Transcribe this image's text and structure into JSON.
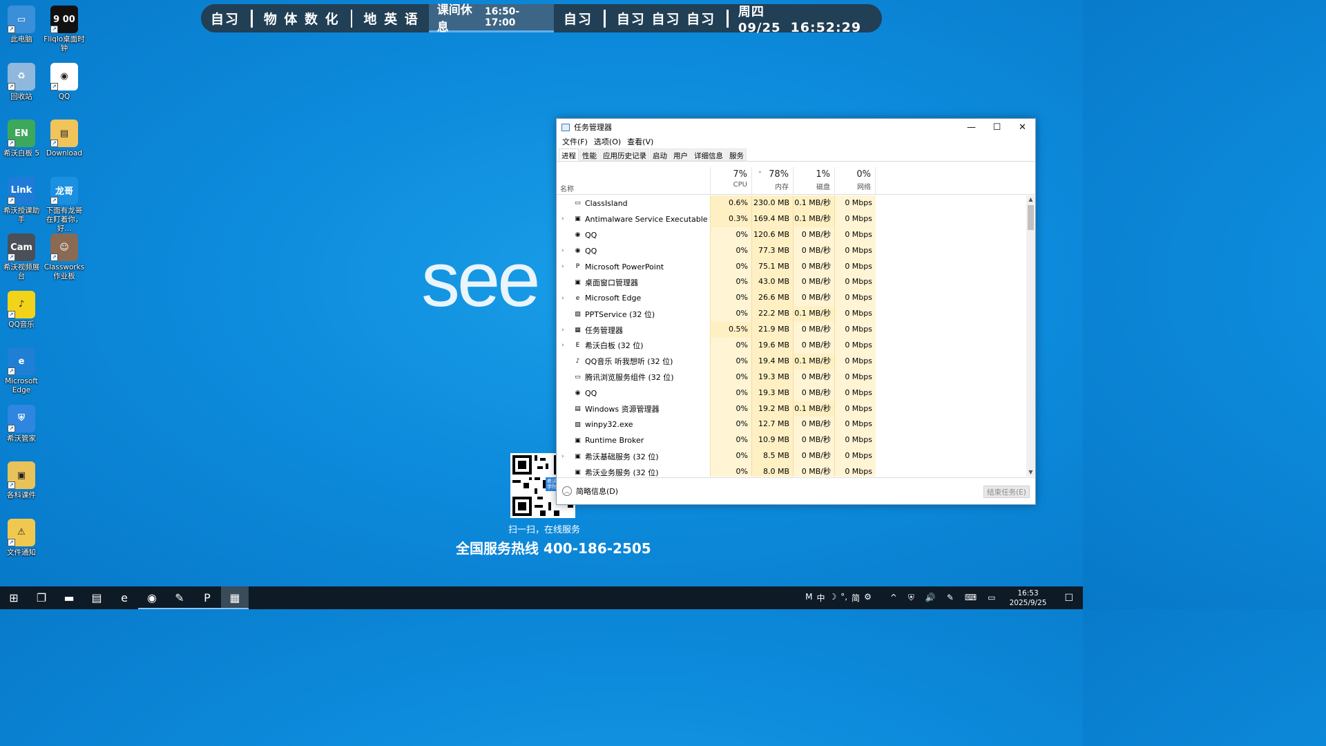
{
  "desktop_icons": [
    {
      "id": "this-pc",
      "label": "此电脑",
      "glyph": "▭",
      "color": "#3a8fd8",
      "col": 0,
      "row": 0
    },
    {
      "id": "fliqlo",
      "label": "Fliqlo桌面时钟",
      "glyph": "9 00",
      "color": "#111111",
      "col": 1,
      "row": 0
    },
    {
      "id": "recycle-bin",
      "label": "回收站",
      "glyph": "♻",
      "color": "#8fb8dc",
      "col": 0,
      "row": 1
    },
    {
      "id": "qq",
      "label": "QQ",
      "glyph": "◉",
      "color": "#ffffff",
      "col": 1,
      "row": 1
    },
    {
      "id": "easinote",
      "label": "希沃白板 5",
      "glyph": "EN",
      "color": "#3da85c",
      "col": 0,
      "row": 2
    },
    {
      "id": "download",
      "label": "Download",
      "glyph": "▤",
      "color": "#f0c45a",
      "col": 1,
      "row": 2
    },
    {
      "id": "link",
      "label": "希沃授课助手",
      "glyph": "Link",
      "color": "#1e7bd8",
      "col": 0,
      "row": 3
    },
    {
      "id": "longge",
      "label": "下面有龙哥在盯着你，好...",
      "glyph": "龙哥",
      "color": "#1b8fe0",
      "col": 1,
      "row": 3
    },
    {
      "id": "camera",
      "label": "希沃视频展台",
      "glyph": "Cam",
      "color": "#4a4f58",
      "col": 0,
      "row": 4
    },
    {
      "id": "classworks",
      "label": "Classworks作业板",
      "glyph": "☺",
      "color": "#8a6a52",
      "col": 1,
      "row": 4
    },
    {
      "id": "qqmusic",
      "label": "QQ音乐",
      "glyph": "♪",
      "color": "#f2d31a",
      "col": 0,
      "row": 5
    },
    {
      "id": "edge",
      "label": "Microsoft Edge",
      "glyph": "e",
      "color": "#1f7fd4",
      "col": 0,
      "row": 6
    },
    {
      "id": "seewo-guard",
      "label": "希沃管家",
      "glyph": "⛨",
      "color": "#2f86e0",
      "col": 0,
      "row": 7
    },
    {
      "id": "courseware",
      "label": "各科课件",
      "glyph": "▣",
      "color": "#e8c35a",
      "col": 0,
      "row": 8
    },
    {
      "id": "file-notice",
      "label": "文件通知",
      "glyph": "⚠",
      "color": "#f0c850",
      "col": 0,
      "row": 9
    }
  ],
  "schedule": {
    "items": [
      "自习",
      "物 体 数 化",
      "地 英 语"
    ],
    "current_label": "课间休息",
    "current_time": "16:50-17:00",
    "after": [
      "自习",
      "自习 自习 自习"
    ],
    "date": "周四 09/25",
    "time": "16:52:29"
  },
  "wallpaper": {
    "logo": "see",
    "qr_badge": "希沃学院",
    "qr_caption": "扫一扫，在线服务",
    "hotline": "全国服务热线 400-186-2505"
  },
  "taskmgr": {
    "title": "任务管理器",
    "menu": [
      "文件(F)",
      "选项(O)",
      "查看(V)"
    ],
    "tabs": [
      "进程",
      "性能",
      "应用历史记录",
      "启动",
      "用户",
      "详细信息",
      "服务"
    ],
    "selected_tab": 0,
    "name_header": "名称",
    "columns": [
      {
        "pct": "7%",
        "name": "CPU"
      },
      {
        "pct": "78%",
        "name": "内存"
      },
      {
        "pct": "1%",
        "name": "磁盘"
      },
      {
        "pct": "0%",
        "name": "网络"
      }
    ],
    "processes": [
      {
        "name": "ClassIsland",
        "expandable": false,
        "icon": "▭",
        "cpu": "0.6%",
        "mem": "230.0 MB",
        "disk": "0.1 MB/秒",
        "net": "0 Mbps"
      },
      {
        "name": "Antimalware Service Executable",
        "expandable": true,
        "icon": "▣",
        "cpu": "0.3%",
        "mem": "169.4 MB",
        "disk": "0.1 MB/秒",
        "net": "0 Mbps"
      },
      {
        "name": "QQ",
        "expandable": false,
        "icon": "◉",
        "cpu": "0%",
        "mem": "120.6 MB",
        "disk": "0 MB/秒",
        "net": "0 Mbps"
      },
      {
        "name": "QQ",
        "expandable": true,
        "icon": "◉",
        "cpu": "0%",
        "mem": "77.3 MB",
        "disk": "0 MB/秒",
        "net": "0 Mbps"
      },
      {
        "name": "Microsoft PowerPoint",
        "expandable": true,
        "icon": "P",
        "cpu": "0%",
        "mem": "75.1 MB",
        "disk": "0 MB/秒",
        "net": "0 Mbps"
      },
      {
        "name": "桌面窗口管理器",
        "expandable": false,
        "icon": "▣",
        "cpu": "0%",
        "mem": "43.0 MB",
        "disk": "0 MB/秒",
        "net": "0 Mbps"
      },
      {
        "name": "Microsoft Edge",
        "expandable": true,
        "icon": "e",
        "cpu": "0%",
        "mem": "26.6 MB",
        "disk": "0 MB/秒",
        "net": "0 Mbps"
      },
      {
        "name": "PPTService (32 位)",
        "expandable": false,
        "icon": "▨",
        "cpu": "0%",
        "mem": "22.2 MB",
        "disk": "0.1 MB/秒",
        "net": "0 Mbps"
      },
      {
        "name": "任务管理器",
        "expandable": true,
        "icon": "▦",
        "cpu": "0.5%",
        "mem": "21.9 MB",
        "disk": "0 MB/秒",
        "net": "0 Mbps"
      },
      {
        "name": "希沃白板 (32 位)",
        "expandable": true,
        "icon": "E",
        "cpu": "0%",
        "mem": "19.6 MB",
        "disk": "0 MB/秒",
        "net": "0 Mbps"
      },
      {
        "name": "QQ音乐 听我想听 (32 位)",
        "expandable": false,
        "icon": "♪",
        "cpu": "0%",
        "mem": "19.4 MB",
        "disk": "0.1 MB/秒",
        "net": "0 Mbps"
      },
      {
        "name": "腾讯浏览服务组件 (32 位)",
        "expandable": false,
        "icon": "▭",
        "cpu": "0%",
        "mem": "19.3 MB",
        "disk": "0 MB/秒",
        "net": "0 Mbps"
      },
      {
        "name": "QQ",
        "expandable": false,
        "icon": "◉",
        "cpu": "0%",
        "mem": "19.3 MB",
        "disk": "0 MB/秒",
        "net": "0 Mbps"
      },
      {
        "name": "Windows 资源管理器",
        "expandable": false,
        "icon": "▤",
        "cpu": "0%",
        "mem": "19.2 MB",
        "disk": "0.1 MB/秒",
        "net": "0 Mbps"
      },
      {
        "name": "winpy32.exe",
        "expandable": false,
        "icon": "▧",
        "cpu": "0%",
        "mem": "12.7 MB",
        "disk": "0 MB/秒",
        "net": "0 Mbps"
      },
      {
        "name": "Runtime Broker",
        "expandable": false,
        "icon": "▣",
        "cpu": "0%",
        "mem": "10.9 MB",
        "disk": "0 MB/秒",
        "net": "0 Mbps"
      },
      {
        "name": "希沃基础服务 (32 位)",
        "expandable": true,
        "icon": "▣",
        "cpu": "0%",
        "mem": "8.5 MB",
        "disk": "0 MB/秒",
        "net": "0 Mbps"
      },
      {
        "name": "希沃业务服务 (32 位)",
        "expandable": false,
        "icon": "▣",
        "cpu": "0%",
        "mem": "8.0 MB",
        "disk": "0 MB/秒",
        "net": "0 Mbps"
      }
    ],
    "fewer_details": "简略信息(D)",
    "end_task": "结束任务(E)"
  },
  "taskbar": {
    "apps": [
      {
        "id": "start",
        "glyph": "⊞",
        "running": false,
        "active": false
      },
      {
        "id": "task-view",
        "glyph": "❐",
        "running": false,
        "active": false
      },
      {
        "id": "camera-app",
        "glyph": "▬",
        "running": false,
        "active": false
      },
      {
        "id": "file-explorer",
        "glyph": "▤",
        "running": false,
        "active": false
      },
      {
        "id": "edge",
        "glyph": "e",
        "running": false,
        "active": false
      },
      {
        "id": "qq",
        "glyph": "◉",
        "running": true,
        "active": false
      },
      {
        "id": "sketch",
        "glyph": "✎",
        "running": true,
        "active": false
      },
      {
        "id": "powerpoint",
        "glyph": "P",
        "running": true,
        "active": false
      },
      {
        "id": "task-manager",
        "glyph": "▦",
        "running": true,
        "active": true
      }
    ],
    "ime": [
      "M",
      "中",
      "☽",
      "°,",
      "简",
      "⚙"
    ],
    "tray_icons": [
      "^",
      "⛨",
      "🔊",
      "✎",
      "⌨",
      "▭"
    ],
    "clock_time": "16:53",
    "clock_date": "2025/9/25",
    "notification": "☐"
  },
  "colors": {
    "schedule_bg": "#213f55",
    "schedule_active": "#3d6585",
    "cpu_highlight_strong": "#fff0c4",
    "cpu_highlight": "#fff4d4",
    "taskbar_bg": "#0e1a26"
  }
}
